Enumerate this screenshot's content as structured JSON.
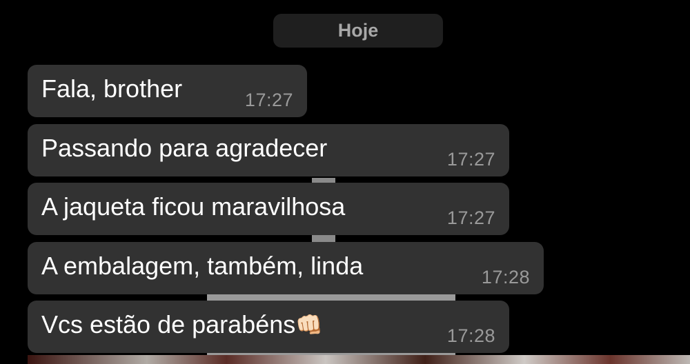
{
  "chat": {
    "date_label": "Hoje",
    "messages": [
      {
        "text": "Fala, brother",
        "time": "17:27"
      },
      {
        "text": "Passando para agradecer",
        "time": "17:27"
      },
      {
        "text": "A jaqueta ficou maravilhosa",
        "time": "17:27"
      },
      {
        "text": "A embalagem, também, linda",
        "time": "17:28"
      },
      {
        "text": "Vcs estão de parabéns",
        "emoji": "👊🏻",
        "time": "17:28"
      }
    ]
  },
  "theme": {
    "background": "#000000",
    "bubble": "#323232",
    "text": "#ffffff",
    "timestamp": "#9a9a9a",
    "date_pill": "#1f1f1f"
  }
}
